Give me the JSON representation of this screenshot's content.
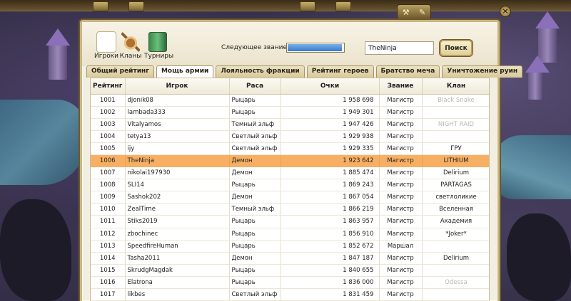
{
  "search": {
    "value": "TheNinja",
    "button_label": "Поиск"
  },
  "categories": [
    {
      "label": "Игроки",
      "icon": "players-icon",
      "active": true
    },
    {
      "label": "Кланы",
      "icon": "clans-icon",
      "active": false
    },
    {
      "label": "Турниры",
      "icon": "tournaments-icon",
      "active": false
    }
  ],
  "next_rank": {
    "label": "Следующее звание:",
    "progress_fraction": 0.97
  },
  "tabs": [
    {
      "label": "Общий рейтинг",
      "active": false
    },
    {
      "label": "Мощь армии",
      "active": true
    },
    {
      "label": "Лояльность фракции",
      "active": false
    },
    {
      "label": "Рейтинг героев",
      "active": false
    },
    {
      "label": "Братство меча",
      "active": false
    },
    {
      "label": "Уничтожение руин",
      "active": false
    }
  ],
  "table": {
    "headers": [
      "Рейтинг",
      "Игрок",
      "Раса",
      "Очки",
      "Звание",
      "Клан"
    ],
    "highlight_color": "#f7b063",
    "rows": [
      {
        "rank": "1001",
        "player": "djonik08",
        "race": "Рыцарь",
        "points": "1 958 698",
        "title": "Магистр",
        "clan": "Black Snake",
        "clan_faded": true
      },
      {
        "rank": "1002",
        "player": "lambada333",
        "race": "Рыцарь",
        "points": "1 949 301",
        "title": "Магистр",
        "clan": "",
        "clan_faded": false
      },
      {
        "rank": "1003",
        "player": "Vitalyamos",
        "race": "Темный эльф",
        "points": "1 947 426",
        "title": "Магистр",
        "clan": "NIGHT RAID",
        "clan_faded": true
      },
      {
        "rank": "1004",
        "player": "tetya13",
        "race": "Светлый эльф",
        "points": "1 929 938",
        "title": "Магистр",
        "clan": "",
        "clan_faded": false
      },
      {
        "rank": "1005",
        "player": "ijy",
        "race": "Светлый эльф",
        "points": "1 929 335",
        "title": "Магистр",
        "clan": "ГРУ",
        "clan_faded": false
      },
      {
        "rank": "1006",
        "player": "TheNinja",
        "race": "Демон",
        "points": "1 923 642",
        "title": "Магистр",
        "clan": "LITHIUM",
        "clan_faded": false,
        "highlight": true
      },
      {
        "rank": "1007",
        "player": "nikolai197930",
        "race": "Демон",
        "points": "1 885 474",
        "title": "Магистр",
        "clan": "Delirium",
        "clan_faded": false
      },
      {
        "rank": "1008",
        "player": "SLI14",
        "race": "Рыцарь",
        "points": "1 869 243",
        "title": "Магистр",
        "clan": "PARTAGAS",
        "clan_faded": false
      },
      {
        "rank": "1009",
        "player": "Sashok202",
        "race": "Демон",
        "points": "1 867 054",
        "title": "Магистр",
        "clan": "светлоликие",
        "clan_faded": false
      },
      {
        "rank": "1010",
        "player": "ZealTime",
        "race": "Темный эльф",
        "points": "1 866 219",
        "title": "Магистр",
        "clan": "Вселенная",
        "clan_faded": false
      },
      {
        "rank": "1011",
        "player": "Stiks2019",
        "race": "Рыцарь",
        "points": "1 863 957",
        "title": "Магистр",
        "clan": "Академия",
        "clan_faded": false
      },
      {
        "rank": "1012",
        "player": "zbochinec",
        "race": "Рыцарь",
        "points": "1 856 910",
        "title": "Магистр",
        "clan": "*Joker*",
        "clan_faded": false
      },
      {
        "rank": "1013",
        "player": "SpeedfireHuman",
        "race": "Рыцарь",
        "points": "1 852 672",
        "title": "Маршал",
        "clan": "",
        "clan_faded": false
      },
      {
        "rank": "1014",
        "player": "Tasha2011",
        "race": "Демон",
        "points": "1 847 187",
        "title": "Магистр",
        "clan": "Delirium",
        "clan_faded": false
      },
      {
        "rank": "1015",
        "player": "SkrudgMagdak",
        "race": "Рыцарь",
        "points": "1 840 655",
        "title": "Магистр",
        "clan": "",
        "clan_faded": false
      },
      {
        "rank": "1016",
        "player": "Elatrona",
        "race": "Рыцарь",
        "points": "1 836 000",
        "title": "Магистр",
        "clan": "Odessa",
        "clan_faded": true
      },
      {
        "rank": "1017",
        "player": "likbes",
        "race": "Светлый эльф",
        "points": "1 831 459",
        "title": "Магистр",
        "clan": "",
        "clan_faded": false
      }
    ]
  }
}
